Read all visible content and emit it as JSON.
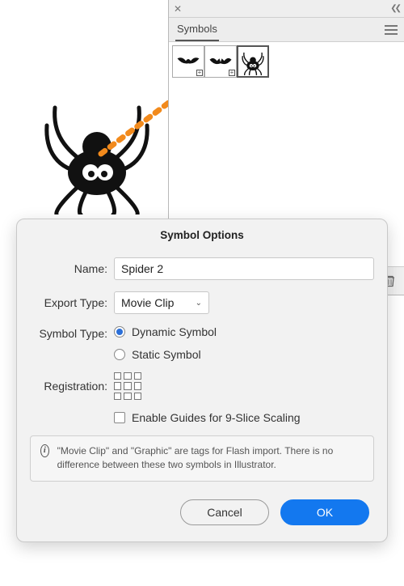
{
  "panel": {
    "title": "Symbols",
    "footer": {
      "new_tooltip": "new-symbol",
      "trash_tooltip": "delete"
    },
    "thumbs": [
      {
        "name": "bat-1"
      },
      {
        "name": "bat-2"
      },
      {
        "name": "spider",
        "selected": true
      }
    ]
  },
  "dialog": {
    "title": "Symbol Options",
    "name_label": "Name:",
    "name_value": "Spider 2",
    "export_label": "Export Type:",
    "export_value": "Movie Clip",
    "symbol_type_label": "Symbol Type:",
    "rb_dynamic": "Dynamic Symbol",
    "rb_static": "Static Symbol",
    "registration_label": "Registration:",
    "cb_guides": "Enable Guides for 9-Slice Scaling",
    "info": "\"Movie Clip\" and \"Graphic\" are tags for Flash import. There is no difference between these two symbols in Illustrator.",
    "cancel": "Cancel",
    "ok": "OK"
  }
}
